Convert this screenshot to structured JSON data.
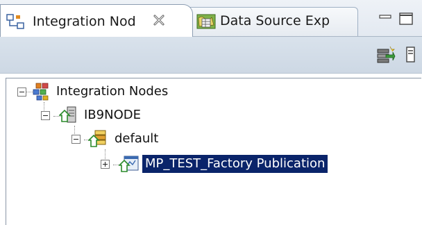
{
  "tabs": [
    {
      "label": "Integration Nod",
      "icon": "integration-nodes-view-icon",
      "active": true
    },
    {
      "label": "Data Source Exp",
      "icon": "data-source-explorer-icon",
      "active": false
    }
  ],
  "window_controls": {
    "minimize": "minimize-icon",
    "maximize": "maximize-icon"
  },
  "toolbar": {
    "buttons": [
      {
        "icon": "connect-node-icon"
      },
      {
        "icon": "view-menu-icon"
      }
    ]
  },
  "tree": {
    "root": {
      "label": "Integration Nodes",
      "icon": "integration-nodes-icon",
      "expanded": true
    },
    "node": {
      "label": "IB9NODE",
      "icon": "integration-node-icon",
      "expanded": true
    },
    "server": {
      "label": "default",
      "icon": "integration-server-icon",
      "expanded": true
    },
    "application": {
      "label": "MP_TEST_Factory Publication",
      "icon": "application-icon",
      "expanded": false,
      "selected": true
    }
  },
  "colors": {
    "selection_bg": "#0a246a",
    "selection_fg": "#ffffff",
    "tabbar_bg": "#e3e9f1",
    "toolbar_bg": "#cdd8e4"
  }
}
